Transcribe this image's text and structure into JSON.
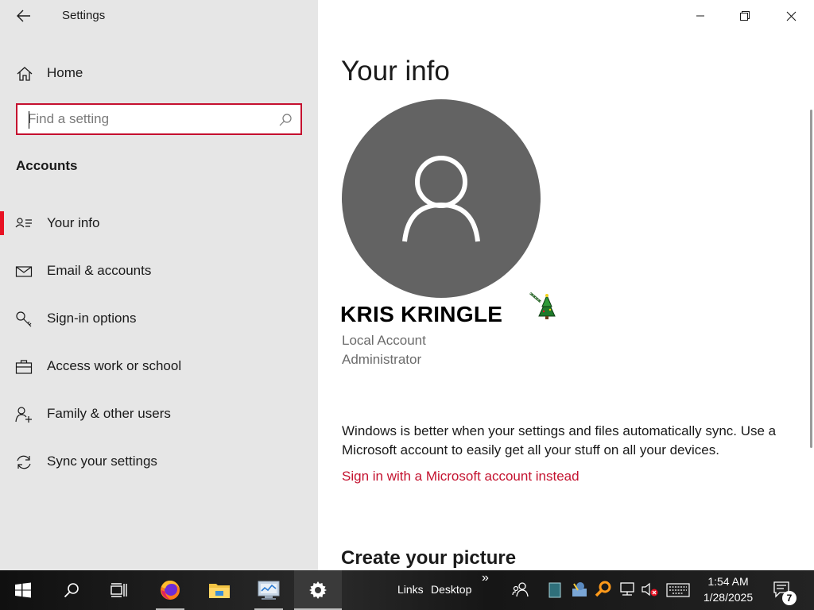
{
  "window": {
    "title": "Settings"
  },
  "sidebar": {
    "home_label": "Home",
    "search": {
      "placeholder": "Find a setting",
      "value": ""
    },
    "section_title": "Accounts",
    "items": [
      {
        "label": "Your info",
        "icon": "contact-info-icon",
        "active": true
      },
      {
        "label": "Email & accounts",
        "icon": "mail-icon"
      },
      {
        "label": "Sign-in options",
        "icon": "key-icon"
      },
      {
        "label": "Access work or school",
        "icon": "briefcase-icon"
      },
      {
        "label": "Family & other users",
        "icon": "add-user-icon"
      },
      {
        "label": "Sync your settings",
        "icon": "sync-icon"
      }
    ]
  },
  "main": {
    "title": "Your info",
    "user": {
      "name": "KRIS KRINGLE",
      "account_type": "Local Account",
      "role": "Administrator"
    },
    "sync_message": "Windows is better when your settings and files automatically sync. Use a Microsoft account to easily get all your stuff on all your devices.",
    "microsoft_link": "Sign in with a Microsoft account instead",
    "create_picture_heading": "Create your picture"
  },
  "taskbar": {
    "toolbars": [
      "Links",
      "Desktop"
    ],
    "overflow": "»",
    "clock": {
      "time": "1:54 AM",
      "date": "1/28/2025"
    },
    "notification_count": "7"
  },
  "colors": {
    "accent": "#e81123",
    "link": "#c4122f",
    "sidebar_bg": "#e6e6e6",
    "avatar_bg": "#636363"
  }
}
